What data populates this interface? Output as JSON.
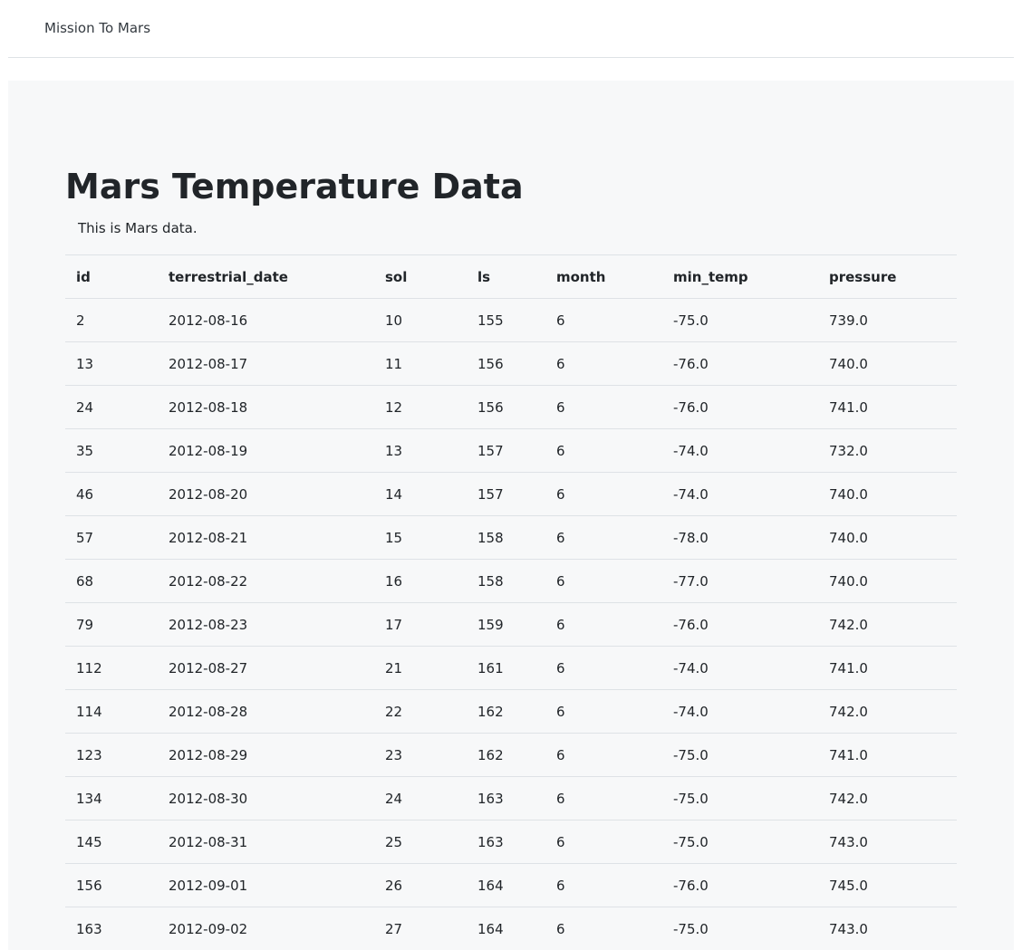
{
  "navbar": {
    "brand": "Mission To Mars"
  },
  "main": {
    "title": "Mars Temperature Data",
    "lead": "This is Mars data."
  },
  "table": {
    "columns": [
      "id",
      "terrestrial_date",
      "sol",
      "ls",
      "month",
      "min_temp",
      "pressure"
    ],
    "rows": [
      [
        "2",
        "2012-08-16",
        "10",
        "155",
        "6",
        "-75.0",
        "739.0"
      ],
      [
        "13",
        "2012-08-17",
        "11",
        "156",
        "6",
        "-76.0",
        "740.0"
      ],
      [
        "24",
        "2012-08-18",
        "12",
        "156",
        "6",
        "-76.0",
        "741.0"
      ],
      [
        "35",
        "2012-08-19",
        "13",
        "157",
        "6",
        "-74.0",
        "732.0"
      ],
      [
        "46",
        "2012-08-20",
        "14",
        "157",
        "6",
        "-74.0",
        "740.0"
      ],
      [
        "57",
        "2012-08-21",
        "15",
        "158",
        "6",
        "-78.0",
        "740.0"
      ],
      [
        "68",
        "2012-08-22",
        "16",
        "158",
        "6",
        "-77.0",
        "740.0"
      ],
      [
        "79",
        "2012-08-23",
        "17",
        "159",
        "6",
        "-76.0",
        "742.0"
      ],
      [
        "112",
        "2012-08-27",
        "21",
        "161",
        "6",
        "-74.0",
        "741.0"
      ],
      [
        "114",
        "2012-08-28",
        "22",
        "162",
        "6",
        "-74.0",
        "742.0"
      ],
      [
        "123",
        "2012-08-29",
        "23",
        "162",
        "6",
        "-75.0",
        "741.0"
      ],
      [
        "134",
        "2012-08-30",
        "24",
        "163",
        "6",
        "-75.0",
        "742.0"
      ],
      [
        "145",
        "2012-08-31",
        "25",
        "163",
        "6",
        "-75.0",
        "743.0"
      ],
      [
        "156",
        "2012-09-01",
        "26",
        "164",
        "6",
        "-76.0",
        "745.0"
      ],
      [
        "163",
        "2012-09-02",
        "27",
        "164",
        "6",
        "-75.0",
        "743.0"
      ]
    ]
  }
}
